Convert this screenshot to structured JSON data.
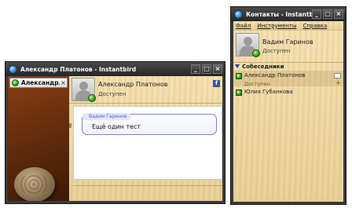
{
  "chat_window": {
    "title": "Александр Платонов - Instantbird",
    "tab_label": "Александр...",
    "contact_name": "Александр Платонов",
    "contact_status": "Доступен",
    "facebook_badge": "f",
    "message": {
      "author": "Вадим Гаринов",
      "text": "Ещё один тест"
    }
  },
  "contacts_window": {
    "title": "Контакты - Instantbird",
    "menu": [
      "Файл",
      "Инструменты",
      "Справка"
    ],
    "me": {
      "name": "Вадим Гаринов",
      "status": "Доступен"
    },
    "group": {
      "name": "Собеседники",
      "contacts": [
        {
          "name": "Александр Платонов",
          "status": "Доступен"
        },
        {
          "name": "Юлия Губанкова",
          "status": ""
        }
      ]
    }
  },
  "window_buttons": {
    "minimize": "_",
    "maximize": "□",
    "close": "×"
  },
  "colors": {
    "titlebar": "#2e2e2e",
    "wood": "#efd9a4",
    "bubble_border": "#7b82d8",
    "online": "#2fa012"
  }
}
